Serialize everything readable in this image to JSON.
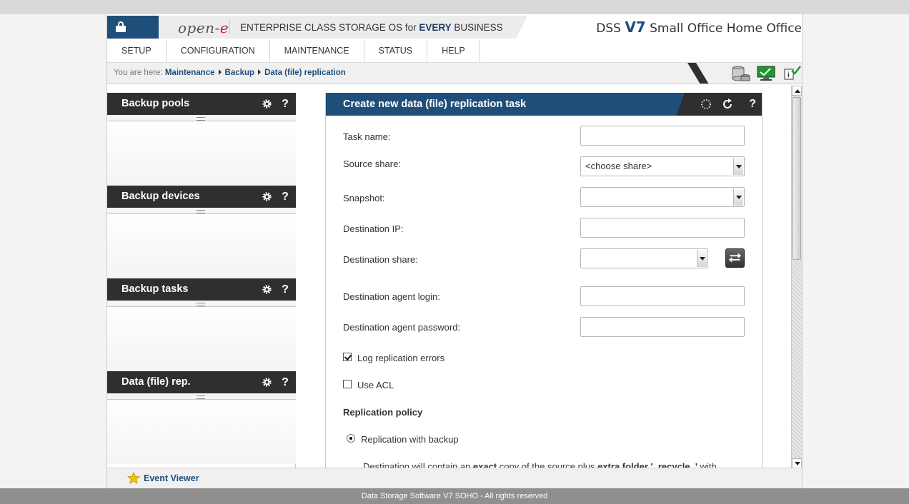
{
  "header": {
    "logo_text": "open-",
    "logo_accent": "e",
    "slogan_prefix": "ENTERPRISE CLASS STORAGE OS for ",
    "slogan_bold": "EVERY",
    "slogan_suffix": " BUSINESS",
    "brand_prefix": "DSS ",
    "brand_version": "V7",
    "brand_suffix": " Small Office Home Office",
    "lock_icon": "lock-icon",
    "accent_color": "#1f4e7a"
  },
  "menu": {
    "items": [
      "SETUP",
      "CONFIGURATION",
      "MAINTENANCE",
      "STATUS",
      "HELP"
    ]
  },
  "breadcrumb": {
    "prefix": "You are here:",
    "items": [
      "Maintenance",
      "Backup",
      "Data (file) replication"
    ]
  },
  "left_panels": [
    {
      "title": "Backup pools",
      "help": "?"
    },
    {
      "title": "Backup devices",
      "help": "?"
    },
    {
      "title": "Backup tasks",
      "help": "?"
    },
    {
      "title": "Data (file) rep.",
      "help": "?"
    }
  ],
  "form": {
    "title": "Create new data (file) replication task",
    "help": "?",
    "task_name_label": "Task name:",
    "task_name_value": "",
    "source_share_label": "Source share:",
    "source_share_value": "<choose share>",
    "snapshot_label": "Snapshot:",
    "snapshot_value": "",
    "destination_ip_label": "Destination IP:",
    "destination_ip_value": "",
    "destination_share_label": "Destination share:",
    "destination_share_value": "",
    "agent_login_label": "Destination agent login:",
    "agent_login_value": "",
    "agent_password_label": "Destination agent password:",
    "agent_password_value": "",
    "log_errors_label": "Log replication errors",
    "log_errors_checked": true,
    "use_acl_label": "Use ACL",
    "use_acl_checked": false,
    "policy_title": "Replication policy",
    "policy_option": "Replication with backup",
    "policy_selected": true,
    "desc_1": "Destination will contain an ",
    "desc_b1": "exact",
    "desc_2": " copy of the source plus ",
    "desc_b2": "extra folder '_recycle_'",
    "desc_3": " with"
  },
  "event_viewer": {
    "label": "Event Viewer"
  },
  "footer": {
    "text": "Data Storage Software V7 SOHO - All rights reserved"
  }
}
